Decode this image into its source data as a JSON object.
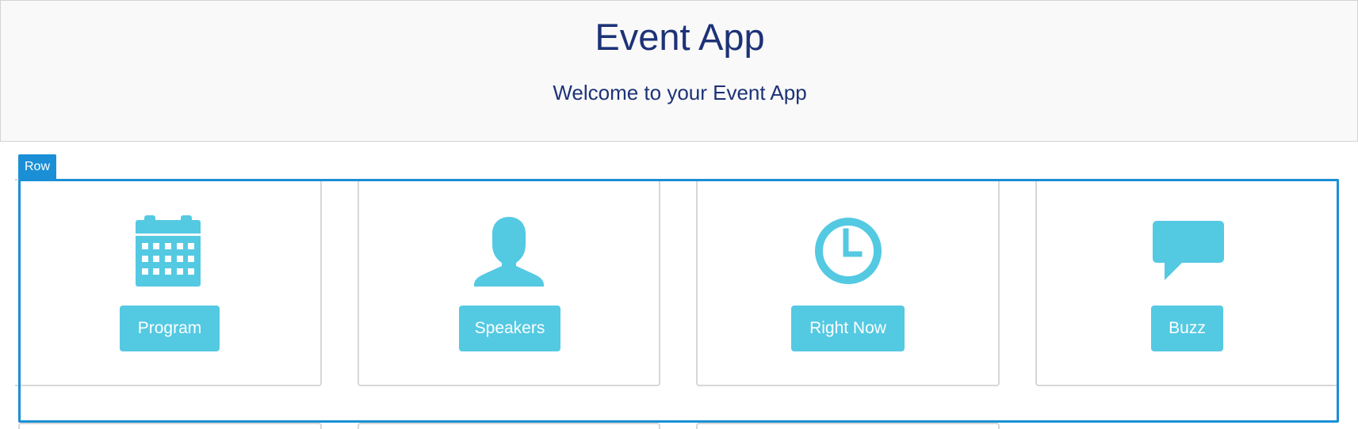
{
  "header": {
    "title": "Event App",
    "subtitle": "Welcome to your Event App"
  },
  "editor": {
    "row_tag": "Row"
  },
  "tiles": [
    {
      "label": "Program",
      "icon": "calendar-icon"
    },
    {
      "label": "Speakers",
      "icon": "person-icon"
    },
    {
      "label": "Right Now",
      "icon": "clock-icon"
    },
    {
      "label": "Buzz",
      "icon": "speech-bubble-icon"
    }
  ],
  "colors": {
    "accent": "#54c9e2",
    "title_text": "#1d3277",
    "selection": "#1a8fd6",
    "header_bg": "#f9f9f9"
  }
}
